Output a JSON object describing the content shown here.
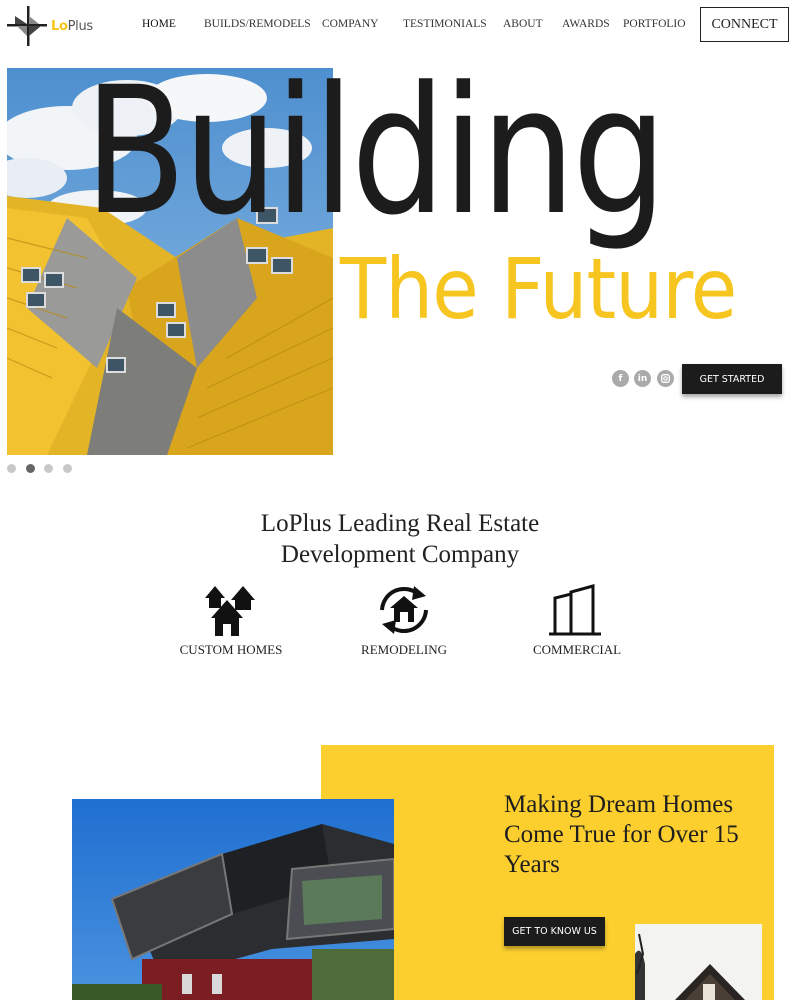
{
  "brand": {
    "logo_prefix": "Lo",
    "logo_suffix": "Plus",
    "accent_color": "#f7c51f",
    "dark_color": "#1c1c1c"
  },
  "nav": {
    "items": [
      {
        "label": "HOME",
        "active": true
      },
      {
        "label": "BUILDS/REMODELS",
        "active": false
      },
      {
        "label": "COMPANY",
        "active": false
      },
      {
        "label": "TESTIMONIALS",
        "active": false
      },
      {
        "label": "ABOUT",
        "active": false
      },
      {
        "label": "AWARDS",
        "active": false
      },
      {
        "label": "PORTFOLIO",
        "active": false
      }
    ],
    "connect_label": "CONNECT"
  },
  "hero": {
    "title": "Building",
    "subtitle": "The Future",
    "cta_label": "GET STARTED",
    "social_icons": [
      "facebook-icon",
      "linkedin-icon",
      "instagram-icon"
    ],
    "slides_total": 4,
    "active_slide": 2
  },
  "intro": {
    "heading_line1": "LoPlus Leading Real Estate",
    "heading_line2": "Development Company",
    "services": [
      {
        "label": "CUSTOM HOMES",
        "icon": "houses-icon"
      },
      {
        "label": "REMODELING",
        "icon": "remodel-cycle-icon"
      },
      {
        "label": "COMMERCIAL",
        "icon": "building-icon"
      }
    ]
  },
  "dream": {
    "heading": "Making Dream Homes Come True for Over 15 Years",
    "cta_label": "GET TO KNOW US",
    "panel_color": "#fccf2f"
  }
}
